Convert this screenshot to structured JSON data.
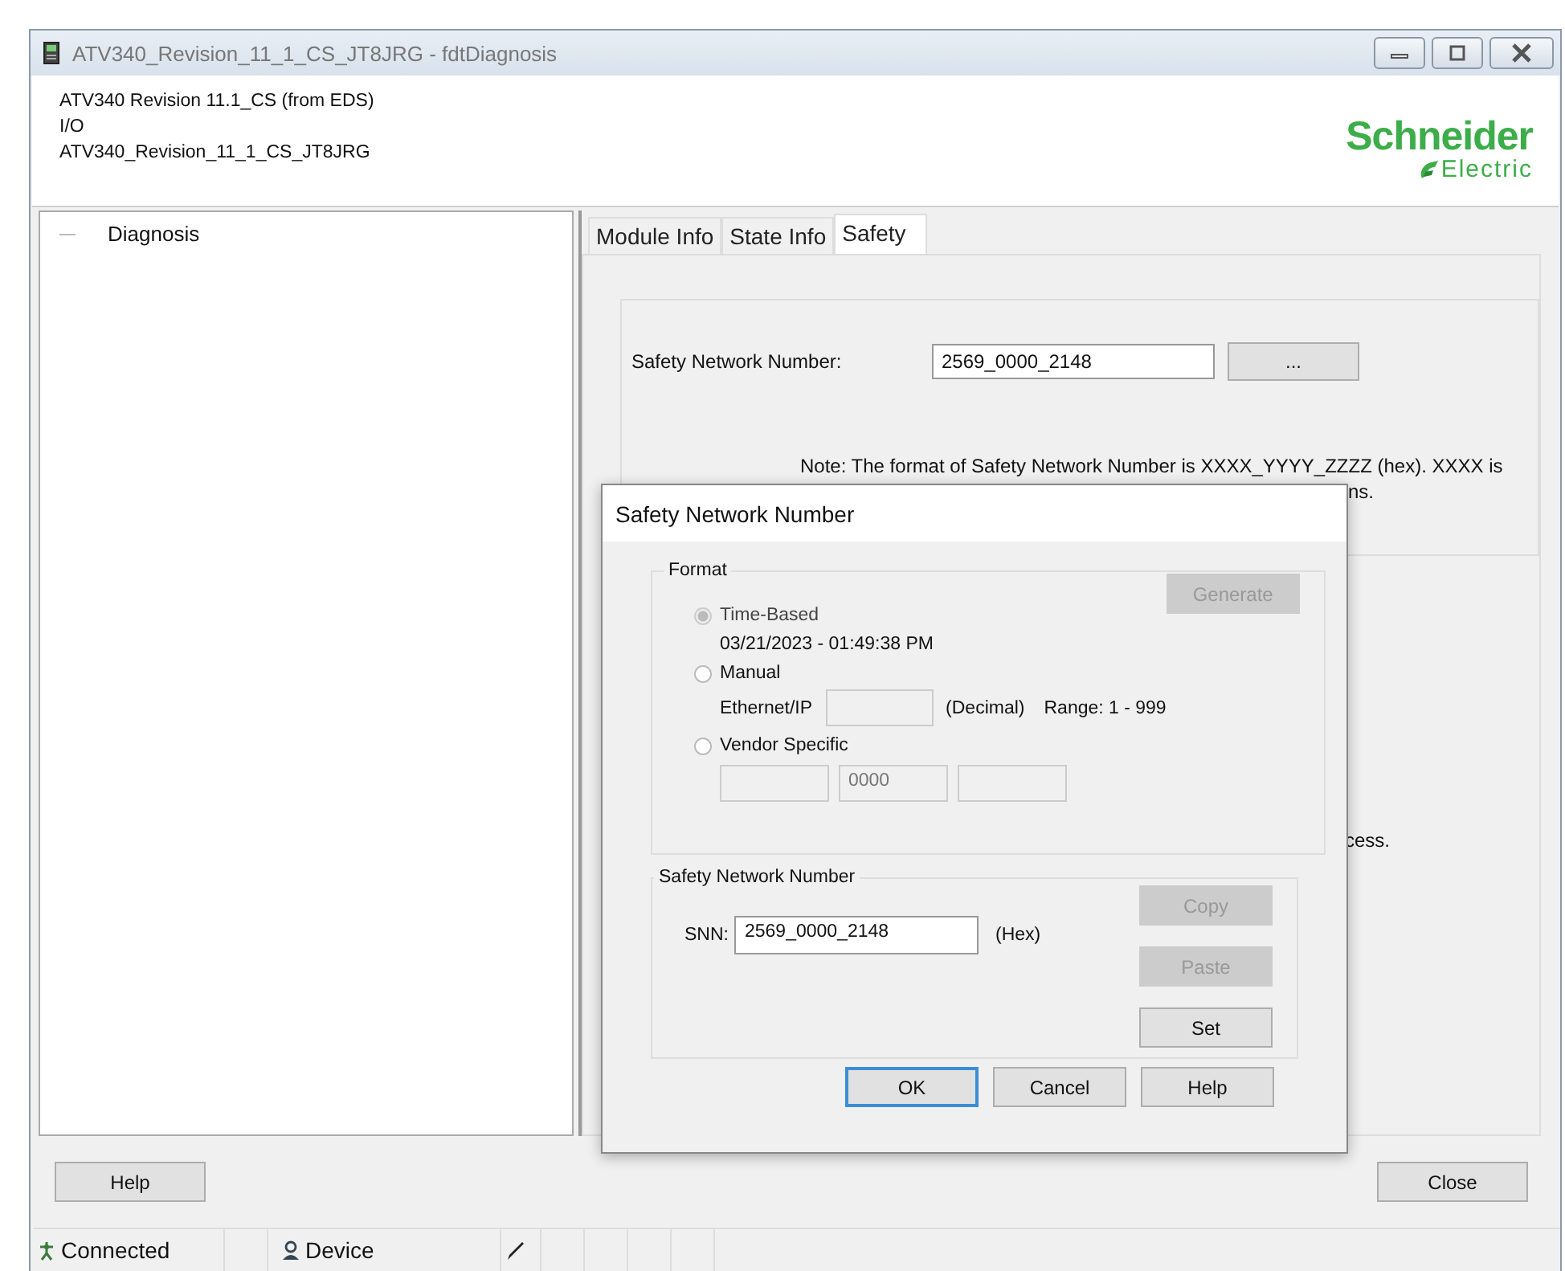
{
  "window": {
    "title": "ATV340_Revision_11_1_CS_JT8JRG - fdtDiagnosis"
  },
  "header": {
    "lines": [
      "ATV340 Revision 11.1_CS (from EDS)",
      "I/O",
      "ATV340_Revision_11_1_CS_JT8JRG"
    ],
    "logo": {
      "name": "Schneider",
      "sub": "Electric"
    }
  },
  "tree": {
    "items": [
      {
        "label": "Diagnosis"
      }
    ]
  },
  "tabs": [
    {
      "label": "Module Info",
      "selected": false
    },
    {
      "label": "State Info",
      "selected": false
    },
    {
      "label": "Safety",
      "selected": true
    }
  ],
  "safety_panel": {
    "snn_label": "Safety Network Number:",
    "snn_value": "2569_0000_2148",
    "browse_button": "...",
    "note_line": "Note: The format of Safety Network Number is XXXX_YYYY_ZZZZ (hex). XXXX is",
    "note_fragments": [
      "ns.",
      "cess."
    ]
  },
  "dialog": {
    "title": "Safety Network Number",
    "format_group": {
      "title": "Format",
      "generate_button": {
        "label": "Generate",
        "disabled": true
      },
      "options": [
        {
          "kind": "time",
          "label": "Time-Based",
          "selected": true,
          "disabled": true,
          "detail": "03/21/2023 - 01:49:38 PM"
        },
        {
          "kind": "manual",
          "label": "Manual",
          "selected": false,
          "disabled": false,
          "field_label": "Ethernet/IP",
          "unit": "(Decimal)",
          "range": "Range: 1 - 999"
        },
        {
          "kind": "vendor",
          "label": "Vendor Specific",
          "selected": false,
          "disabled": false,
          "fields": [
            {
              "disabled": true
            },
            {
              "value": "0000",
              "disabled": true
            },
            {
              "disabled": true
            }
          ]
        }
      ]
    },
    "snn_group": {
      "title": "Safety Network Number",
      "label": "SNN:",
      "value": "2569_0000_2148",
      "unit": "(Hex)",
      "buttons": [
        {
          "label": "Copy",
          "disabled": true
        },
        {
          "label": "Paste",
          "disabled": true
        },
        {
          "label": "Set",
          "disabled": false
        }
      ]
    },
    "buttons": [
      {
        "label": "OK",
        "default": true
      },
      {
        "label": "Cancel",
        "default": false
      },
      {
        "label": "Help",
        "default": false
      }
    ]
  },
  "footer": {
    "help_button": "Help",
    "close_button": "Close"
  },
  "status_bar": {
    "connection": "Connected",
    "device": "Device"
  }
}
